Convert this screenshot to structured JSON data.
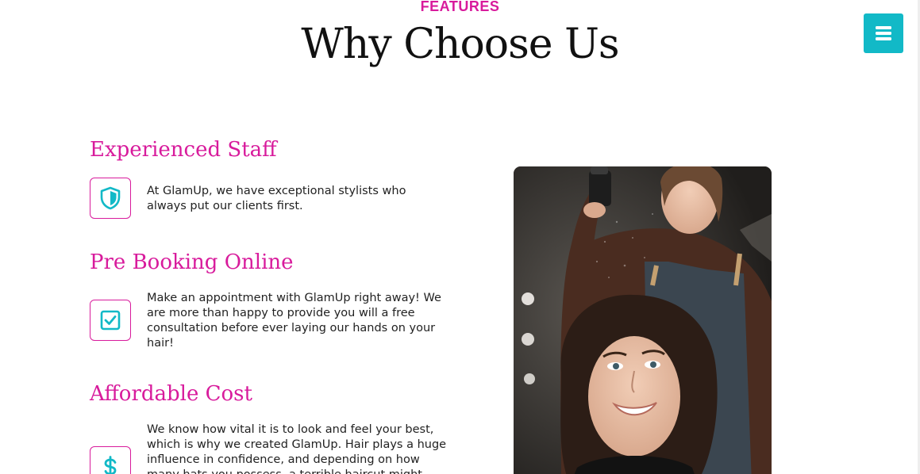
{
  "section": {
    "eyebrow": "FEATURES",
    "title": "Why Choose Us"
  },
  "menu_button": {
    "icon": "hamburger-menu-icon"
  },
  "features": [
    {
      "title": "Experienced Staff",
      "icon": "shield-icon",
      "text": "At GlamUp, we have exceptional stylists who always put our clients first."
    },
    {
      "title": "Pre Booking Online",
      "icon": "checkbox-icon",
      "text": "Make an appointment with GlamUp right away! We are more than happy to provide you will a free consultation before ever laying our hands on your hair!"
    },
    {
      "title": "Affordable Cost",
      "icon": "dollar-icon",
      "text": "We know how vital it is to look and feel your best, which is why we created GlamUp. Hair plays a huge influence in confidence, and depending on how many hats you possess, a terrible haircut might"
    }
  ],
  "photo": {
    "subject": "stylist-spraying-client-hair-photo"
  },
  "colors": {
    "accent_pink": "#d81b9c",
    "accent_teal": "#12b9c7",
    "text_dark": "#111111"
  }
}
